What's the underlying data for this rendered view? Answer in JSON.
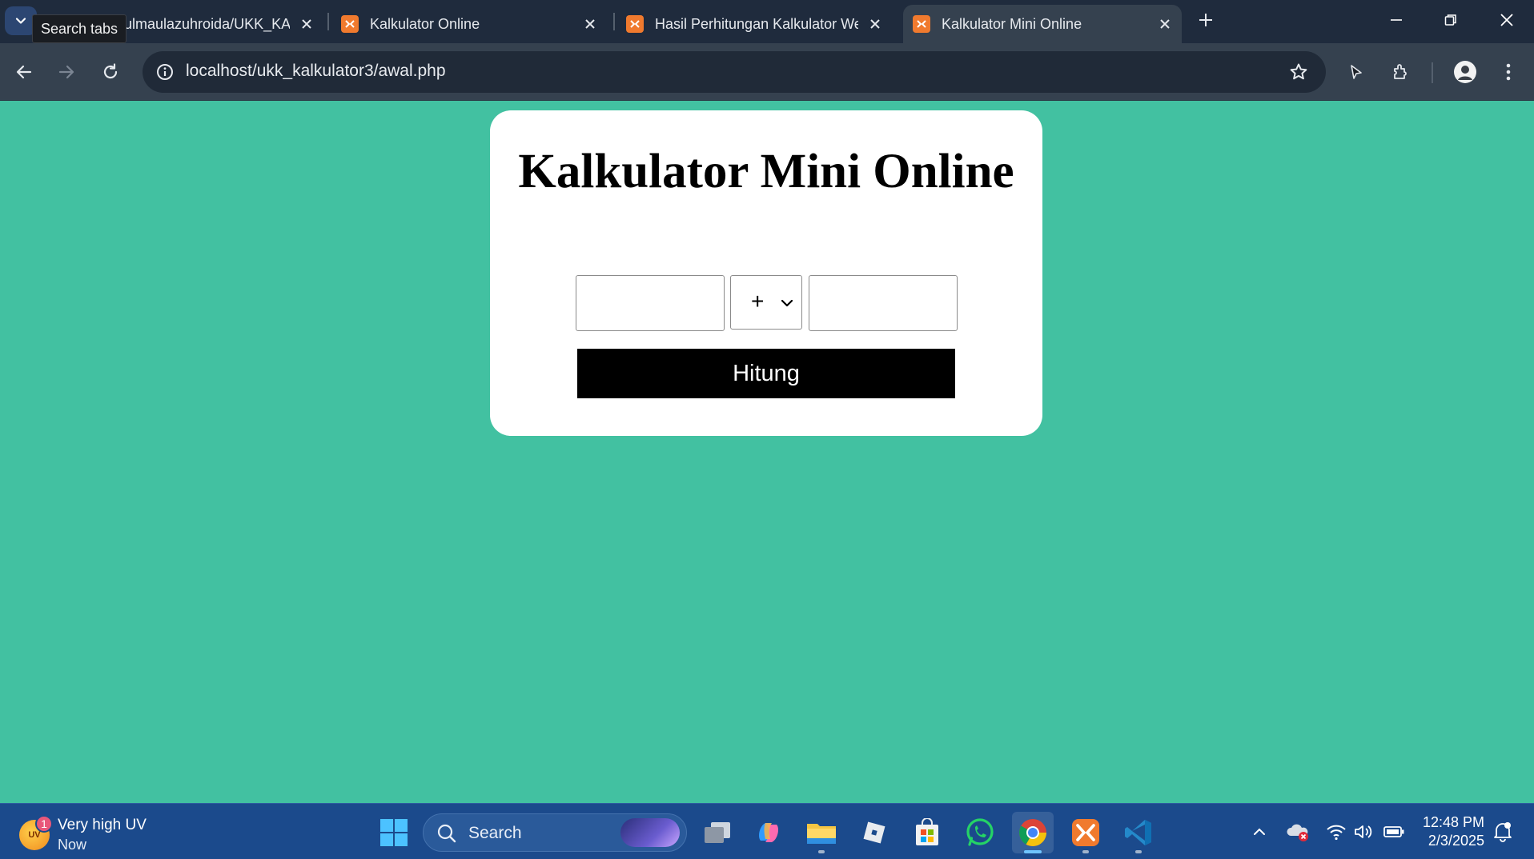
{
  "browser": {
    "tooltip": "Search tabs",
    "tabs": [
      {
        "title": "tulmaulazuhroida/UKK_KA",
        "active": false
      },
      {
        "title": "Kalkulator Online",
        "active": false
      },
      {
        "title": "Hasil Perhitungan Kalkulator We",
        "active": false
      },
      {
        "title": "Kalkulator Mini Online",
        "active": true
      }
    ],
    "url": "localhost/ukk_kalkulator3/awal.php"
  },
  "page": {
    "heading": "Kalkulator Mini Online",
    "operand1_value": "",
    "operand2_value": "",
    "operator_selected": "+",
    "submit_label": "Hitung",
    "background_color": "#42c1a1"
  },
  "taskbar": {
    "weather": {
      "title": "Very high UV",
      "subtitle": "Now",
      "badge": "1",
      "icon_text": "UV"
    },
    "search_label": "Search",
    "clock": {
      "time": "12:48 PM",
      "date": "2/3/2025"
    }
  }
}
